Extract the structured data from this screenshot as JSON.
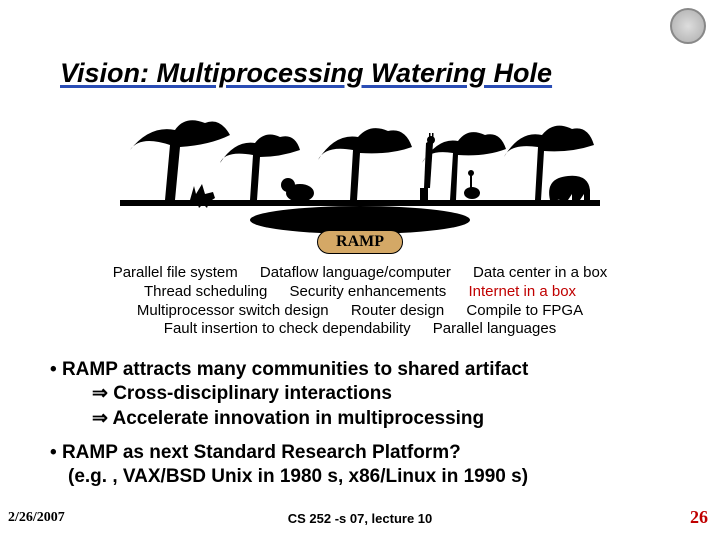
{
  "title": "Vision: Multiprocessing Watering Hole",
  "ramp_label": "RAMP",
  "topics": {
    "r1a": "Parallel file system",
    "r1b": "Dataflow language/computer",
    "r1c": "Data center in a box",
    "r2a": "Thread scheduling",
    "r2b": "Security enhancements",
    "r2c": "Internet in a box",
    "r3a": "Multiprocessor switch design",
    "r3b": "Router design",
    "r3c": "Compile to FPGA",
    "r4a": "Fault insertion to check dependability",
    "r4b": "Parallel languages"
  },
  "bullets": {
    "b1": "RAMP attracts many communities to shared artifact",
    "b1s1": "⇒ Cross-disciplinary interactions",
    "b1s2": "⇒ Accelerate innovation in multiprocessing",
    "b2": "RAMP as next Standard Research Platform?",
    "b2s1": "(e.g. , VAX/BSD Unix in 1980 s, x86/Linux in 1990 s)"
  },
  "footer": {
    "date": "2/26/2007",
    "center": "CS 252 -s 07, lecture 10",
    "page": "26"
  }
}
